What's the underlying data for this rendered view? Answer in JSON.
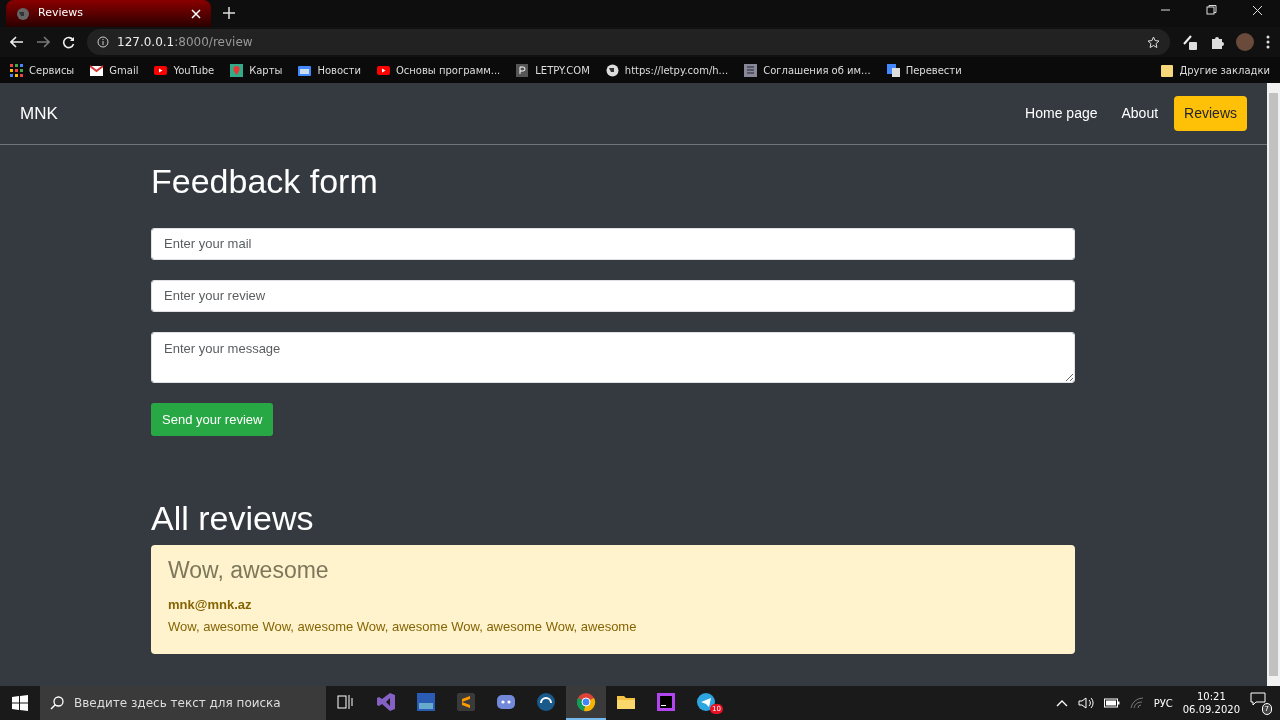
{
  "browser": {
    "tab": {
      "title": "Reviews",
      "selected": true
    },
    "address": {
      "host": "127.0.0.1",
      "path": ":8000/review"
    },
    "bookmarks": [
      {
        "kind": "apps",
        "label": "Сервисы"
      },
      {
        "kind": "gmail",
        "label": "Gmail"
      },
      {
        "kind": "youtube",
        "label": "YouTube"
      },
      {
        "kind": "maps",
        "label": "Карты"
      },
      {
        "kind": "news",
        "label": "Новости"
      },
      {
        "kind": "youtube",
        "label": "Основы программ..."
      },
      {
        "kind": "letter",
        "label": "LETPY.COM"
      },
      {
        "kind": "globe",
        "label": "https://letpy.com/h..."
      },
      {
        "kind": "doc",
        "label": "Соглашения об им..."
      },
      {
        "kind": "translate",
        "label": "Перевести"
      }
    ],
    "other_bookmarks": "Другие закладки"
  },
  "page": {
    "navbar": {
      "brand": "MNK",
      "links": [
        {
          "label": "Home page",
          "selected": false
        },
        {
          "label": "About",
          "selected": false
        },
        {
          "label": "Reviews",
          "selected": true
        }
      ]
    },
    "form": {
      "title": "Feedback form",
      "fields": [
        {
          "kind": "input",
          "placeholder": "Enter your mail"
        },
        {
          "kind": "input",
          "placeholder": "Enter your review"
        },
        {
          "kind": "textarea",
          "placeholder": "Enter your message"
        }
      ],
      "submit": "Send your review"
    },
    "reviews": {
      "title": "All reviews",
      "items": [
        {
          "title": "Wow, awesome",
          "email": "mnk@mnk.az",
          "text": "Wow, awesome Wow, awesome Wow, awesome Wow, awesome Wow, awesome"
        }
      ]
    }
  },
  "taskbar": {
    "search_placeholder": "Введите здесь текст для поиска",
    "apps": [
      {
        "kind": "taskview",
        "selected": false
      },
      {
        "kind": "vs",
        "selected": false
      },
      {
        "kind": "dev",
        "selected": false
      },
      {
        "kind": "sublime",
        "selected": false
      },
      {
        "kind": "discord",
        "selected": false
      },
      {
        "kind": "headset",
        "selected": false
      },
      {
        "kind": "chrome",
        "selected": true
      },
      {
        "kind": "folder",
        "selected": false
      },
      {
        "kind": "phpstorm",
        "selected": false
      },
      {
        "kind": "telegram",
        "selected": false,
        "badge": "10"
      }
    ],
    "language": "РУС",
    "time": "10:21",
    "date": "06.09.2020",
    "notifications": "7"
  }
}
